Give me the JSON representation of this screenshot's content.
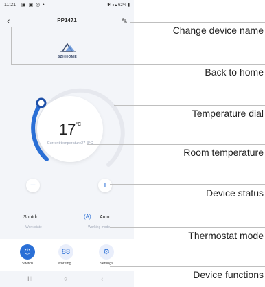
{
  "status_bar": {
    "time": "11:21",
    "right": "62%"
  },
  "header": {
    "title": "PP1471",
    "back_glyph": "‹",
    "edit_glyph": "✎"
  },
  "brand": {
    "logo_text": "SZHHOME"
  },
  "thermostat": {
    "set_temperature": "17",
    "unit": "°C",
    "current_temperature": "Current temperature27-3°C",
    "minus_label": "−",
    "plus_label": "+"
  },
  "status": {
    "state_value": "Shutdo...",
    "state_label": "Work state",
    "mode_value": "Auto",
    "mode_label": "Working mode"
  },
  "functions": [
    {
      "label": "Switch",
      "icon": "power-icon",
      "glyph": "⏻"
    },
    {
      "label": "Working...",
      "icon": "grid-icon",
      "glyph": "88"
    },
    {
      "label": "Settings",
      "icon": "gear-icon",
      "glyph": "⚙"
    }
  ],
  "nav_bar": {
    "recents": "III",
    "home": "○",
    "back": "‹"
  },
  "callouts": {
    "change_name": "Change device name",
    "back_home": "Back to home",
    "temp_dial": "Temperature dial",
    "room_temp": "Room temperature",
    "device_status": "Device status",
    "thermostat_mode": "Thermostat mode",
    "device_functions": "Device functions"
  },
  "colors": {
    "accent": "#2a6fd6",
    "dial_track": "#e6e8ee",
    "background": "#f3f5f9"
  }
}
